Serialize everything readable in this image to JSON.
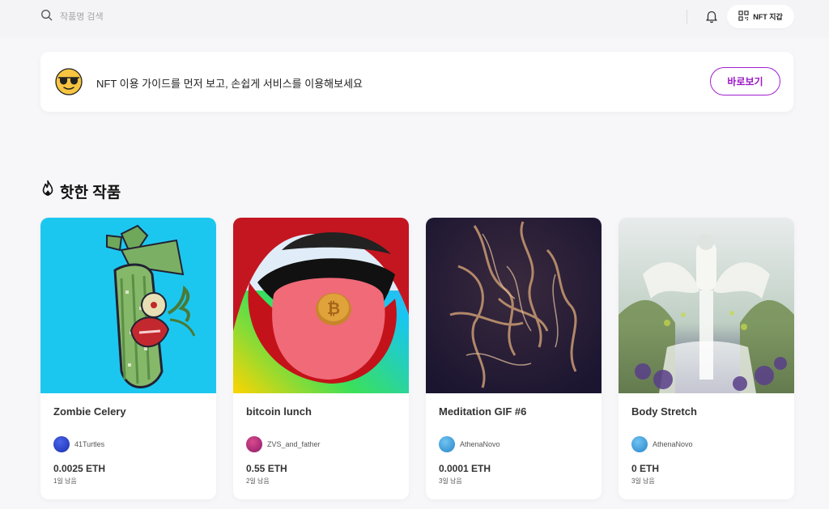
{
  "search": {
    "placeholder": "작품명 검색"
  },
  "header": {
    "wallet_label": "NFT 지갑"
  },
  "banner": {
    "message": "NFT 이용 가이드를 먼저 보고, 손쉽게 서비스를 이용해보세요",
    "button_label": "바로보기"
  },
  "section": {
    "title": "핫한 작품"
  },
  "colors": {
    "accent": "#a21fd0"
  },
  "cards": [
    {
      "title": "Zombie Celery",
      "creator": "41Turtles",
      "price": "0.0025 ETH",
      "remaining": "1일 남음"
    },
    {
      "title": "bitcoin lunch",
      "creator": "ZVS_and_father",
      "price": "0.55 ETH",
      "remaining": "2일 남음"
    },
    {
      "title": "Meditation GIF #6",
      "creator": "AthenaNovo",
      "price": "0.0001 ETH",
      "remaining": "3일 남음"
    },
    {
      "title": "Body Stretch",
      "creator": "AthenaNovo",
      "price": "0 ETH",
      "remaining": "3일 남음"
    }
  ]
}
